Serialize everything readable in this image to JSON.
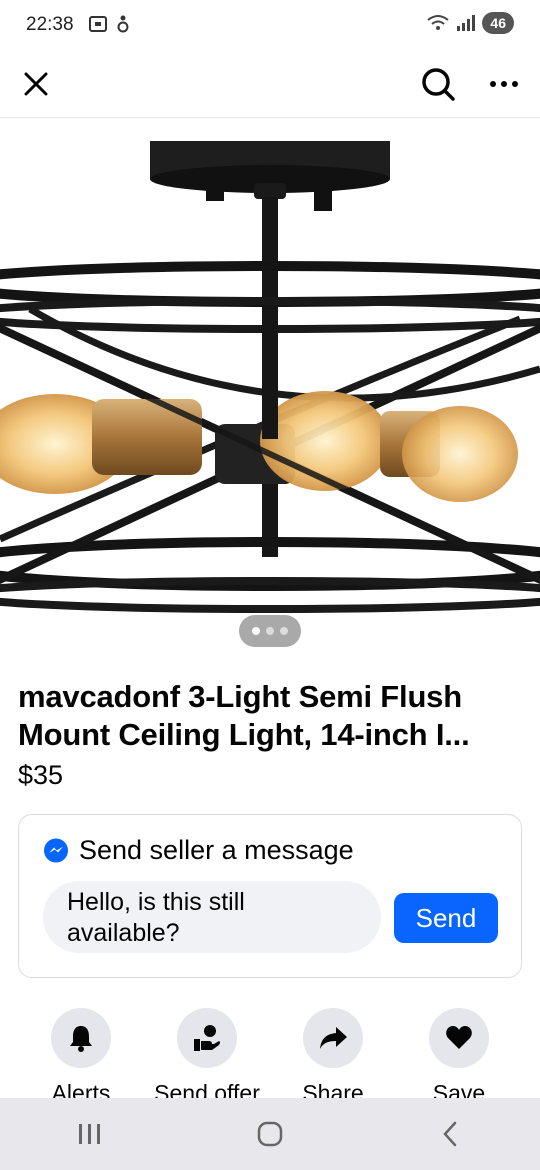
{
  "status_bar": {
    "time": "22:38",
    "battery": "46"
  },
  "product": {
    "title_line1": "mavcadonf 3-Light Semi Flush",
    "title_line2": "Mount Ceiling Light, 14-inch I...",
    "price": "$35",
    "image_count": 3,
    "image_active_index": 0
  },
  "message": {
    "heading": "Send seller a message",
    "input_line1": "Hello, is this still",
    "input_line2": "available?",
    "send_label": "Send"
  },
  "actions": [
    {
      "label": "Alerts",
      "icon": "bell-icon"
    },
    {
      "label": "Send offer",
      "icon": "offer-icon"
    },
    {
      "label": "Share",
      "icon": "share-icon"
    },
    {
      "label": "Save",
      "icon": "heart-icon"
    }
  ],
  "colors": {
    "accent": "#0866ff",
    "messenger": "#0866ff",
    "chip_background": "#e4e6eb"
  }
}
